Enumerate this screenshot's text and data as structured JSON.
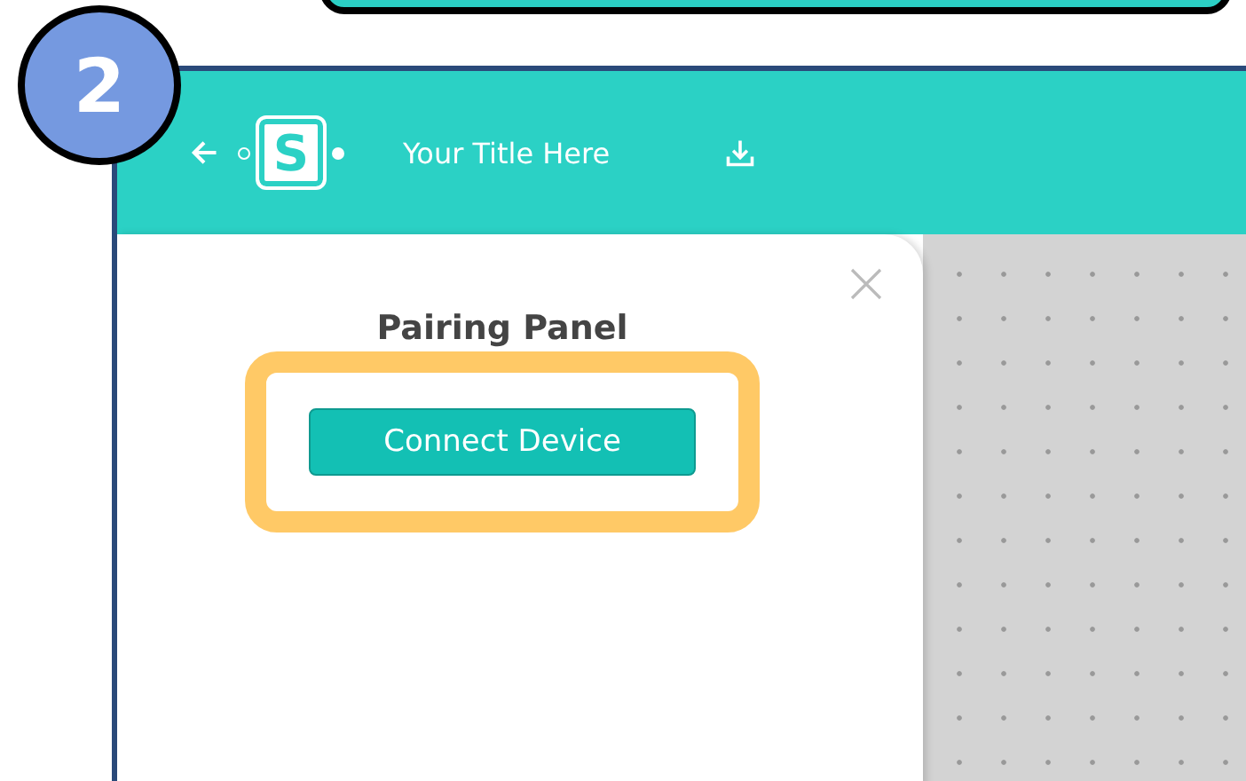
{
  "step_badge": "2",
  "header": {
    "logo_letter": "S",
    "title": "Your Title Here"
  },
  "panel": {
    "title": "Pairing Panel",
    "button": "Connect Device",
    "highlighted": true
  }
}
